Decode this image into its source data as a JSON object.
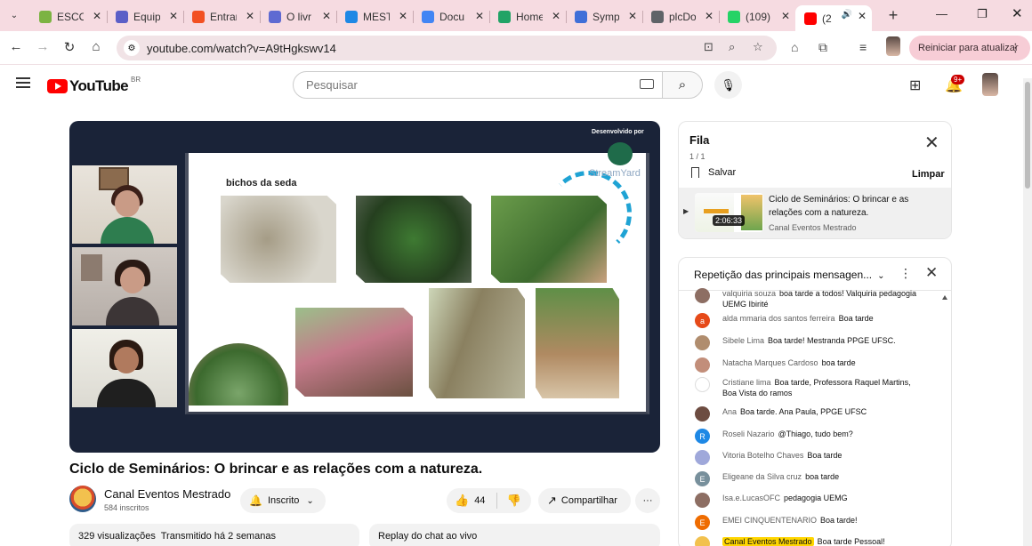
{
  "browser": {
    "tabs": [
      {
        "label": "ESCO",
        "color": "#7cb342"
      },
      {
        "label": "Equip",
        "color": "#5b5fc7"
      },
      {
        "label": "Entrar",
        "color": "#f25022"
      },
      {
        "label": "O livr",
        "color": "#5e6ad2"
      },
      {
        "label": "MEST",
        "color": "#1e88e5"
      },
      {
        "label": "Docu",
        "color": "#4285f4"
      },
      {
        "label": "Home",
        "color": "#21a366"
      },
      {
        "label": "Symp",
        "color": "#3f6fd8"
      },
      {
        "label": "plcDo",
        "color": "#5f6368"
      },
      {
        "label": "(109)",
        "color": "#25d366"
      },
      {
        "label": "(2",
        "color": "#ff0000"
      }
    ],
    "url": "youtube.com/watch?v=A9tHgkswv14",
    "reload_label": "Reiniciar para atualizar"
  },
  "youtube": {
    "logo_text": "YouTube",
    "region": "BR",
    "search_placeholder": "Pesquisar",
    "notification_count": "9+"
  },
  "video": {
    "slide_title": "bichos da seda",
    "watermark": "Desenvolvido por",
    "watermark_brand": "StreamYard",
    "title": "Ciclo de Seminários: O brincar e as relações com a natureza.",
    "channel": "Canal Eventos Mestrado",
    "subscribers": "584 inscritos",
    "subscribe_label": "Inscrito",
    "likes": "44",
    "share_label": "Compartilhar",
    "more_label": "···",
    "views_label": "329 visualizações  Transmitido há 2 semanas",
    "chat_replay_label": "Replay do chat ao vivo"
  },
  "queue": {
    "title": "Fila",
    "count": "1 / 1",
    "save_label": "Salvar",
    "clear_label": "Limpar",
    "item": {
      "title": "Ciclo de Seminários: O brincar e as relações com a natureza.",
      "channel": "Canal Eventos Mestrado",
      "duration": "2:06:33"
    }
  },
  "chat": {
    "mode_label": "Repetição das principais mensagen...",
    "messages": [
      {
        "author": "valquiria souza",
        "text": "boa tarde a todos! Valquiria pedagogia UEMG Ibirité",
        "avatar": "",
        "avatar_color": "#8d6e63"
      },
      {
        "author": "alda mmaria dos santos ferreira",
        "text": "Boa tarde",
        "avatar": "a",
        "avatar_color": "#e64a19"
      },
      {
        "author": "Sibele Lima",
        "text": "Boa tarde! Mestranda PPGE UFSC.",
        "avatar": "",
        "avatar_color": "#b08d6e"
      },
      {
        "author": "Natacha Marques Cardoso",
        "text": "boa tarde",
        "avatar": "",
        "avatar_color": "#c28e7a"
      },
      {
        "author": "Cristiane lima",
        "text": "Boa tarde, Professora Raquel Martins, Boa Vista do ramos",
        "avatar": "",
        "avatar_color": "#ffffff"
      },
      {
        "author": "Ana",
        "text": "Boa tarde. Ana Paula, PPGE UFSC",
        "avatar": "",
        "avatar_color": "#6d4c41"
      },
      {
        "author": "Roseli Nazario",
        "text": "@Thiago, tudo bem?",
        "avatar": "R",
        "avatar_color": "#1e88e5"
      },
      {
        "author": "Vitoria Botelho Chaves",
        "text": "Boa tarde",
        "avatar": "",
        "avatar_color": "#9fa8da"
      },
      {
        "author": "Eligeane da Silva cruz",
        "text": "boa tarde",
        "avatar": "E",
        "avatar_color": "#78909c"
      },
      {
        "author": "Isa.e.LucasOFC",
        "text": "pedagogia UEMG",
        "avatar": "",
        "avatar_color": "#8d6e63"
      },
      {
        "author": "EMEI CINQUENTENARIO",
        "text": "Boa tarde!",
        "avatar": "E",
        "avatar_color": "#ef6c00"
      },
      {
        "author": "Canal Eventos Mestrado",
        "text": "Boa tarde Pessoal!",
        "avatar": "",
        "avatar_color": "#f2c14e",
        "owner": true
      }
    ]
  }
}
